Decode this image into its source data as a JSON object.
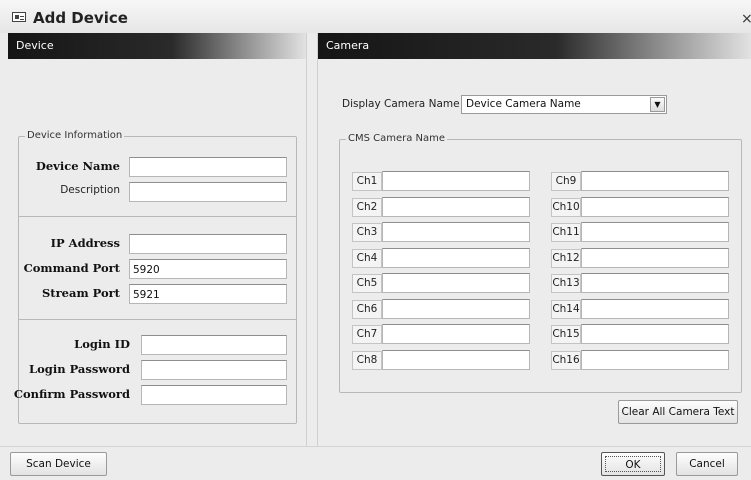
{
  "window": {
    "title": "Add Device",
    "close_glyph": "×"
  },
  "device_panel": {
    "header": "Device",
    "group_title": "Device Information",
    "device_name_label": "Device Name",
    "device_name_value": "",
    "description_label": "Description",
    "description_value": "",
    "ip_address_label": "IP Address",
    "ip_address_value": "",
    "command_port_label": "Command Port",
    "command_port_value": "5920",
    "stream_port_label": "Stream Port",
    "stream_port_value": "5921",
    "login_id_label": "Login ID",
    "login_id_value": "",
    "login_password_label": "Login Password",
    "login_password_value": "",
    "confirm_password_label": "Confirm Password",
    "confirm_password_value": ""
  },
  "camera_panel": {
    "header": "Camera",
    "display_name_label": "Display Camera Name By",
    "display_name_selected": "Device Camera Name",
    "group_title": "CMS Camera Name",
    "channels": [
      {
        "label": "Ch1",
        "value": ""
      },
      {
        "label": "Ch2",
        "value": ""
      },
      {
        "label": "Ch3",
        "value": ""
      },
      {
        "label": "Ch4",
        "value": ""
      },
      {
        "label": "Ch5",
        "value": ""
      },
      {
        "label": "Ch6",
        "value": ""
      },
      {
        "label": "Ch7",
        "value": ""
      },
      {
        "label": "Ch8",
        "value": ""
      },
      {
        "label": "Ch9",
        "value": ""
      },
      {
        "label": "Ch10",
        "value": ""
      },
      {
        "label": "Ch11",
        "value": ""
      },
      {
        "label": "Ch12",
        "value": ""
      },
      {
        "label": "Ch13",
        "value": ""
      },
      {
        "label": "Ch14",
        "value": ""
      },
      {
        "label": "Ch15",
        "value": ""
      },
      {
        "label": "Ch16",
        "value": ""
      }
    ],
    "clear_button": "Clear All Camera Text"
  },
  "footer": {
    "scan_button": "Scan Device",
    "ok_button": "OK",
    "cancel_button": "Cancel"
  },
  "icons": {
    "title_icon": "device-icon",
    "dropdown_icon": "chevron-down-icon"
  },
  "colors": {
    "header_dark": "#151515",
    "background": "#ececec"
  }
}
